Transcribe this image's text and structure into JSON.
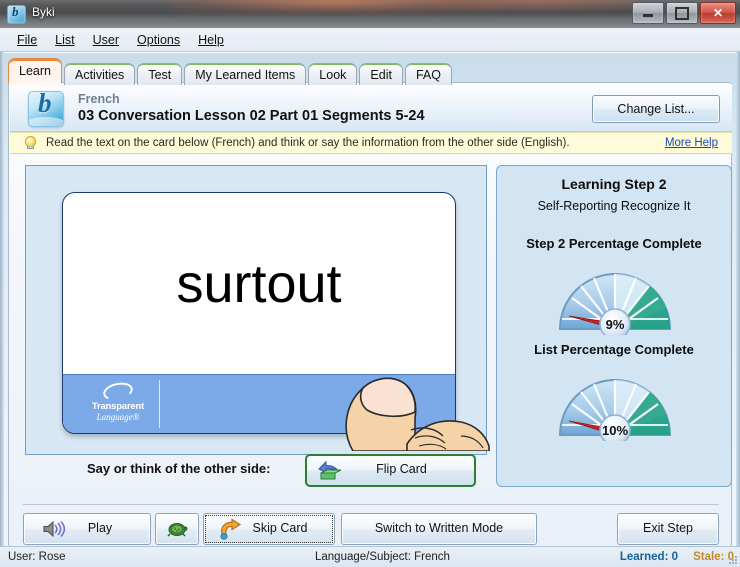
{
  "window": {
    "title": "Byki",
    "app_icon": "byki-logo-icon",
    "controls": {
      "minimize": "minimize-icon",
      "maximize": "maximize-icon",
      "close": "✕"
    }
  },
  "menubar": {
    "items": [
      {
        "label": "File",
        "mnemonic": "F"
      },
      {
        "label": "List",
        "mnemonic": "L"
      },
      {
        "label": "User",
        "mnemonic": "U"
      },
      {
        "label": "Options",
        "mnemonic": "O"
      },
      {
        "label": "Help",
        "mnemonic": "H"
      }
    ]
  },
  "tabs": {
    "active": "Learn",
    "items": [
      {
        "label": "Learn"
      },
      {
        "label": "Activities"
      },
      {
        "label": "Test"
      },
      {
        "label": "My Learned Items"
      },
      {
        "label": "Look"
      },
      {
        "label": "Edit"
      },
      {
        "label": "FAQ"
      }
    ]
  },
  "list_header": {
    "language": "French",
    "list_name": "03 Conversation Lesson 02 Part 01 Segments 5-24",
    "change_list_label": "Change List..."
  },
  "hint": {
    "icon": "lightbulb-icon",
    "text": "Read the text on the card below (French) and think or say the information from the other side (English).",
    "more_help_label": "More Help"
  },
  "card": {
    "word": "surtout",
    "brand_line1": "Transparent",
    "brand_line2": "Language®"
  },
  "prompt": {
    "say_label": "Say or think of the other side:",
    "flip_card_label": "Flip Card",
    "flip_icon": "flip-card-icon"
  },
  "step_panel": {
    "heading": "Learning Step 2",
    "subheading": "Self-Reporting Recognize It",
    "gauge1_title": "Step 2 Percentage Complete",
    "gauge1_value": "9%",
    "gauge2_title": "List Percentage Complete",
    "gauge2_value": "10%"
  },
  "toolbar": {
    "play_label": "Play",
    "play_icon": "speaker-icon",
    "slow_icon": "turtle-icon",
    "skip_label": "Skip Card",
    "skip_icon": "skip-arrow-icon",
    "switch_label": "Switch to Written Mode",
    "exit_label": "Exit Step"
  },
  "statusbar": {
    "user": "User: Rose",
    "language_subject": "Language/Subject: French",
    "learned": "Learned: 0",
    "stale": "Stale: 0"
  },
  "chart_data": [
    {
      "type": "gauge",
      "title": "Step 2 Percentage Complete",
      "value": 9,
      "unit": "%",
      "range": [
        0,
        100
      ],
      "label": "9%",
      "needle_color": "#cc2222",
      "fill_color": "#1ba07e"
    },
    {
      "type": "gauge",
      "title": "List Percentage Complete",
      "value": 10,
      "unit": "%",
      "range": [
        0,
        100
      ],
      "label": "10%",
      "needle_color": "#cc2222",
      "fill_color": "#1ba07e"
    }
  ],
  "colors": {
    "accent_orange": "#f0873a",
    "tab_green": "#7fb85a",
    "card_strip_blue": "#7ca9e8",
    "panel_blue": "#d3e5f2",
    "hint_yellow": "#fdfbd8",
    "link_blue": "#1b49b8",
    "learned_blue": "#16609c",
    "stale_gold": "#c58a2b"
  }
}
